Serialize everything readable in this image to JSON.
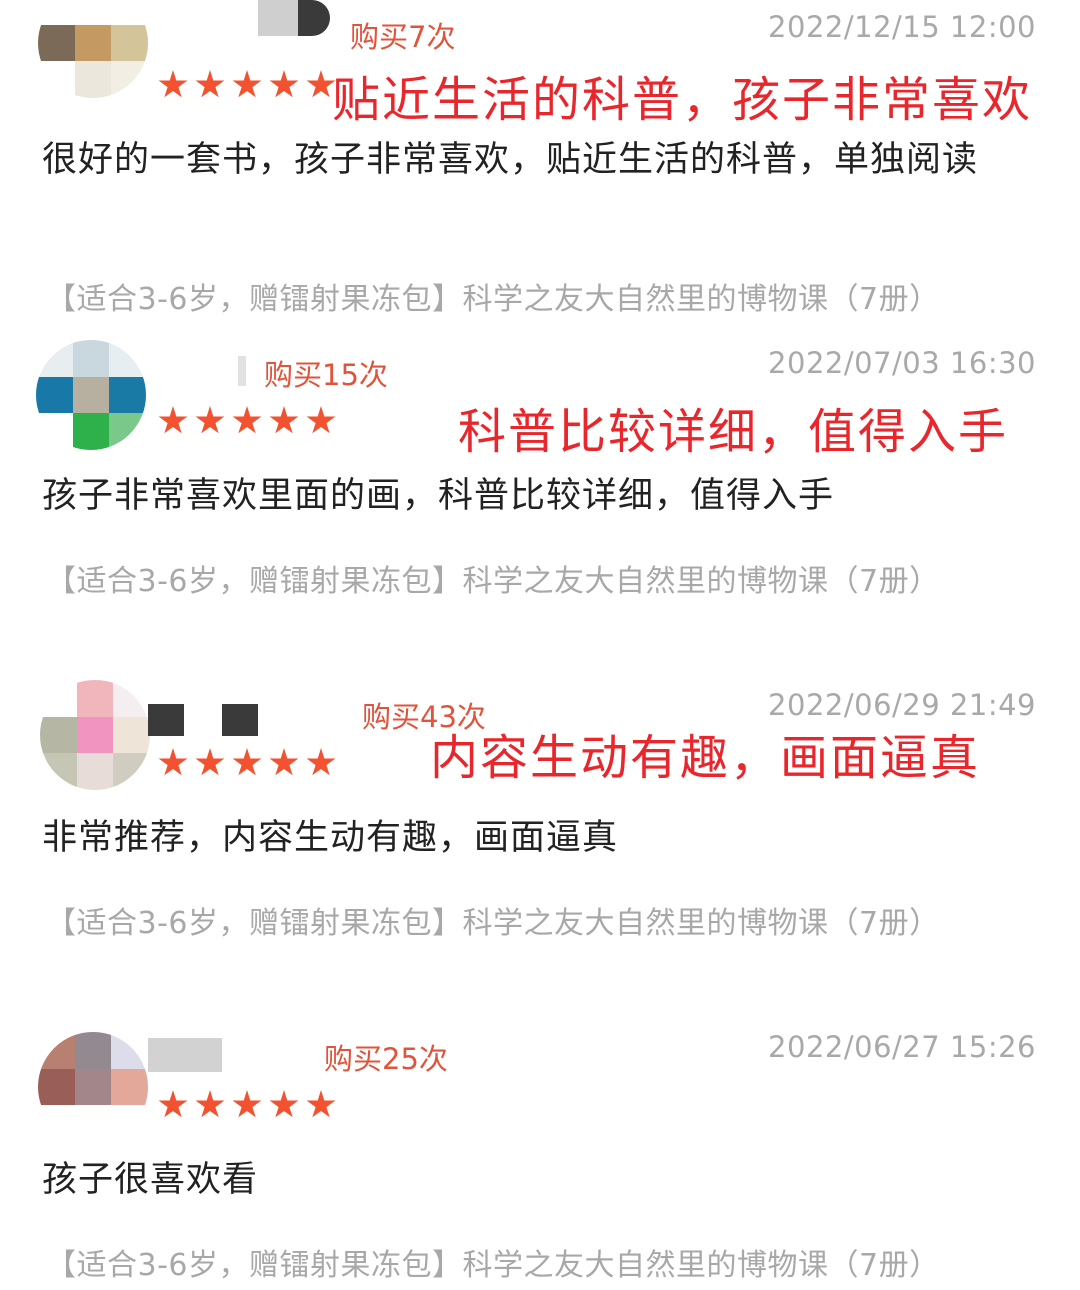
{
  "reviews": [
    {
      "purchase_count": "购买7次",
      "date": "2022/12/15 12:00",
      "rating": 5,
      "annotation": "贴近生活的科普，孩子非常喜欢",
      "text": "很好的一套书，孩子非常喜欢，贴近生活的科普，单独阅读",
      "product": "【适合3-6岁，赠镭射果冻包】科学之友大自然里的博物课（7册）"
    },
    {
      "purchase_count": "购买15次",
      "date": "2022/07/03 16:30",
      "rating": 5,
      "annotation": "科普比较详细，值得入手",
      "text": "孩子非常喜欢里面的画，科普比较详细，值得入手",
      "product": "【适合3-6岁，赠镭射果冻包】科学之友大自然里的博物课（7册）"
    },
    {
      "purchase_count": "购买43次",
      "date": "2022/06/29 21:49",
      "rating": 5,
      "annotation": "内容生动有趣，画面逼真",
      "text": "非常推荐，内容生动有趣，画面逼真",
      "product": "【适合3-6岁，赠镭射果冻包】科学之友大自然里的博物课（7册）"
    },
    {
      "purchase_count": "购买25次",
      "date": "2022/06/27 15:26",
      "rating": 5,
      "annotation": "",
      "text": "孩子很喜欢看",
      "product": "【适合3-6岁，赠镭射果冻包】科学之友大自然里的博物课（7册）"
    }
  ],
  "colors": {
    "star": "#f2522f",
    "purchase": "#e2533a",
    "annotation": "#e8262b",
    "date": "#a9a9a9",
    "product": "#a8a8a8"
  },
  "icons": {
    "rating": "star-icon"
  }
}
